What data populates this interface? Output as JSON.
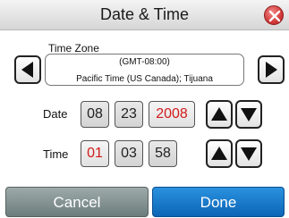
{
  "header": {
    "title": "Date & Time",
    "close_icon": "close-circle-icon"
  },
  "timezone": {
    "label": "Time Zone",
    "offset": "(GMT-08:00)",
    "name": "Pacific Time (US  Canada); Tijuana"
  },
  "date": {
    "label": "Date",
    "month": "08",
    "day": "23",
    "year": "2008",
    "selected_field": "year"
  },
  "time": {
    "label": "Time",
    "hour": "01",
    "minute": "03",
    "second": "58",
    "selected_field": "hour"
  },
  "footer": {
    "cancel_label": "Cancel",
    "done_label": "Done"
  },
  "colors": {
    "accent_blue": "#1a7ccf",
    "highlight_red": "#d21b1b",
    "close_red": "#d23a3a"
  }
}
